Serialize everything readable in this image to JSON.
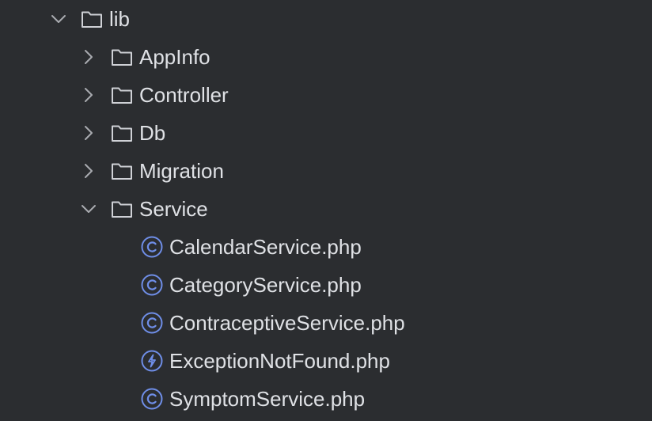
{
  "tree": {
    "root": {
      "label": "lib",
      "expanded": true,
      "icon": "folder-icon"
    },
    "folders": [
      {
        "label": "AppInfo",
        "expanded": false,
        "icon": "folder-icon"
      },
      {
        "label": "Controller",
        "expanded": false,
        "icon": "folder-icon"
      },
      {
        "label": "Db",
        "expanded": false,
        "icon": "folder-icon"
      },
      {
        "label": "Migration",
        "expanded": false,
        "icon": "folder-icon"
      },
      {
        "label": "Service",
        "expanded": true,
        "icon": "folder-icon"
      }
    ],
    "service_files": [
      {
        "label": "CalendarService.php",
        "icon": "php-class-icon"
      },
      {
        "label": "CategoryService.php",
        "icon": "php-class-icon"
      },
      {
        "label": "ContraceptiveService.php",
        "icon": "php-class-icon"
      },
      {
        "label": "ExceptionNotFound.php",
        "icon": "php-exception-icon"
      },
      {
        "label": "SymptomService.php",
        "icon": "php-class-icon"
      }
    ]
  },
  "colors": {
    "background": "#2b2d30",
    "text": "#dfe1e5",
    "chevron": "#a9abb0",
    "folder_outline": "#cfd1d6",
    "class_icon": "#6f8ee8"
  }
}
